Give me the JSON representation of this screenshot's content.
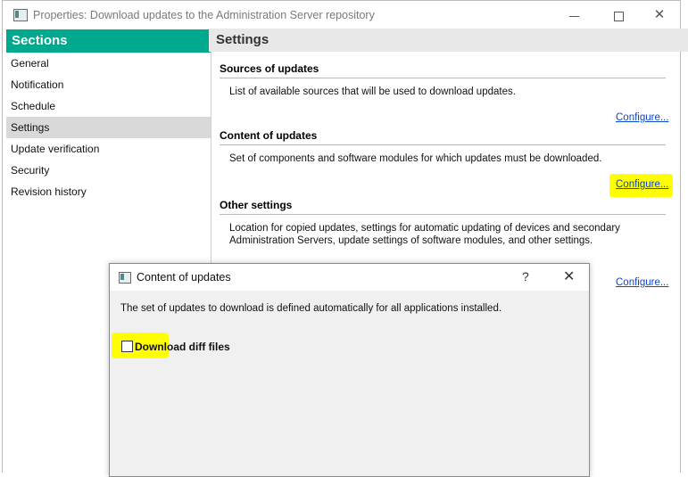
{
  "window": {
    "title": "Properties: Download updates to the Administration Server repository",
    "controls": {
      "minimize_icon": "minimize-icon",
      "maximize_icon": "maximize-icon",
      "close_icon": "close-icon"
    }
  },
  "sidebar": {
    "header": "Sections",
    "items": [
      {
        "label": "General",
        "selected": false
      },
      {
        "label": "Notification",
        "selected": false
      },
      {
        "label": "Schedule",
        "selected": false
      },
      {
        "label": "Settings",
        "selected": true
      },
      {
        "label": "Update verification",
        "selected": false
      },
      {
        "label": "Security",
        "selected": false
      },
      {
        "label": "Revision history",
        "selected": false
      }
    ]
  },
  "settings": {
    "header": "Settings",
    "groups": [
      {
        "title": "Sources of updates",
        "description": "List of available sources that will be used to download updates.",
        "link": "Configure..."
      },
      {
        "title": "Content of updates",
        "description": "Set of components and software modules for which updates must be downloaded.",
        "link": "Configure..."
      },
      {
        "title": "Other settings",
        "description": "Location for copied updates, settings for automatic updating of devices and secondary Administration Servers, update settings of software modules, and other settings.",
        "link": "Configure..."
      }
    ]
  },
  "dialog": {
    "title": "Content of updates",
    "help": "?",
    "close": "✕",
    "message": "The set of updates to download is defined automatically for all applications installed.",
    "checkbox": {
      "label": "Download diff files",
      "checked": false
    }
  },
  "colors": {
    "accent": "#00a88e",
    "highlight": "#ffff00",
    "link": "#0b47c9"
  }
}
